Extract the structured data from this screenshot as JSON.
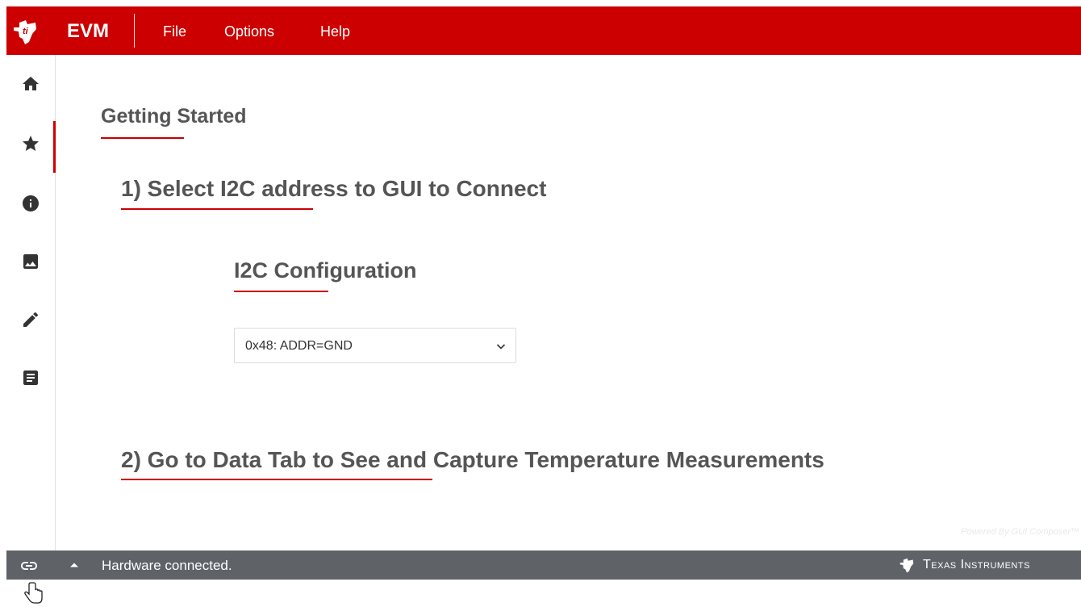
{
  "header": {
    "title": "EVM",
    "menu": [
      {
        "label": "File"
      },
      {
        "label": "Options"
      },
      {
        "label": "Help"
      }
    ]
  },
  "sidebar": {
    "items": [
      {
        "icon": "home-icon"
      },
      {
        "icon": "star-icon",
        "active": true
      },
      {
        "icon": "info-icon"
      },
      {
        "icon": "image-icon"
      },
      {
        "icon": "pencil-icon"
      },
      {
        "icon": "notes-icon"
      }
    ]
  },
  "content": {
    "page_title": "Getting Started",
    "step1": "1) Select I2C address to GUI to Connect",
    "config_title": "I2C Configuration",
    "address_select": {
      "value": "0x48: ADDR=GND"
    },
    "step2": "2) Go to Data Tab to See and Capture Temperature Measurements",
    "powered_by": "Powered By GUI Composer™"
  },
  "status_bar": {
    "message": "Hardware connected.",
    "brand": "Texas Instruments"
  },
  "colors": {
    "brand_red": "#cc0000",
    "status_bar": "#5f6368",
    "heading_text": "#555555"
  }
}
